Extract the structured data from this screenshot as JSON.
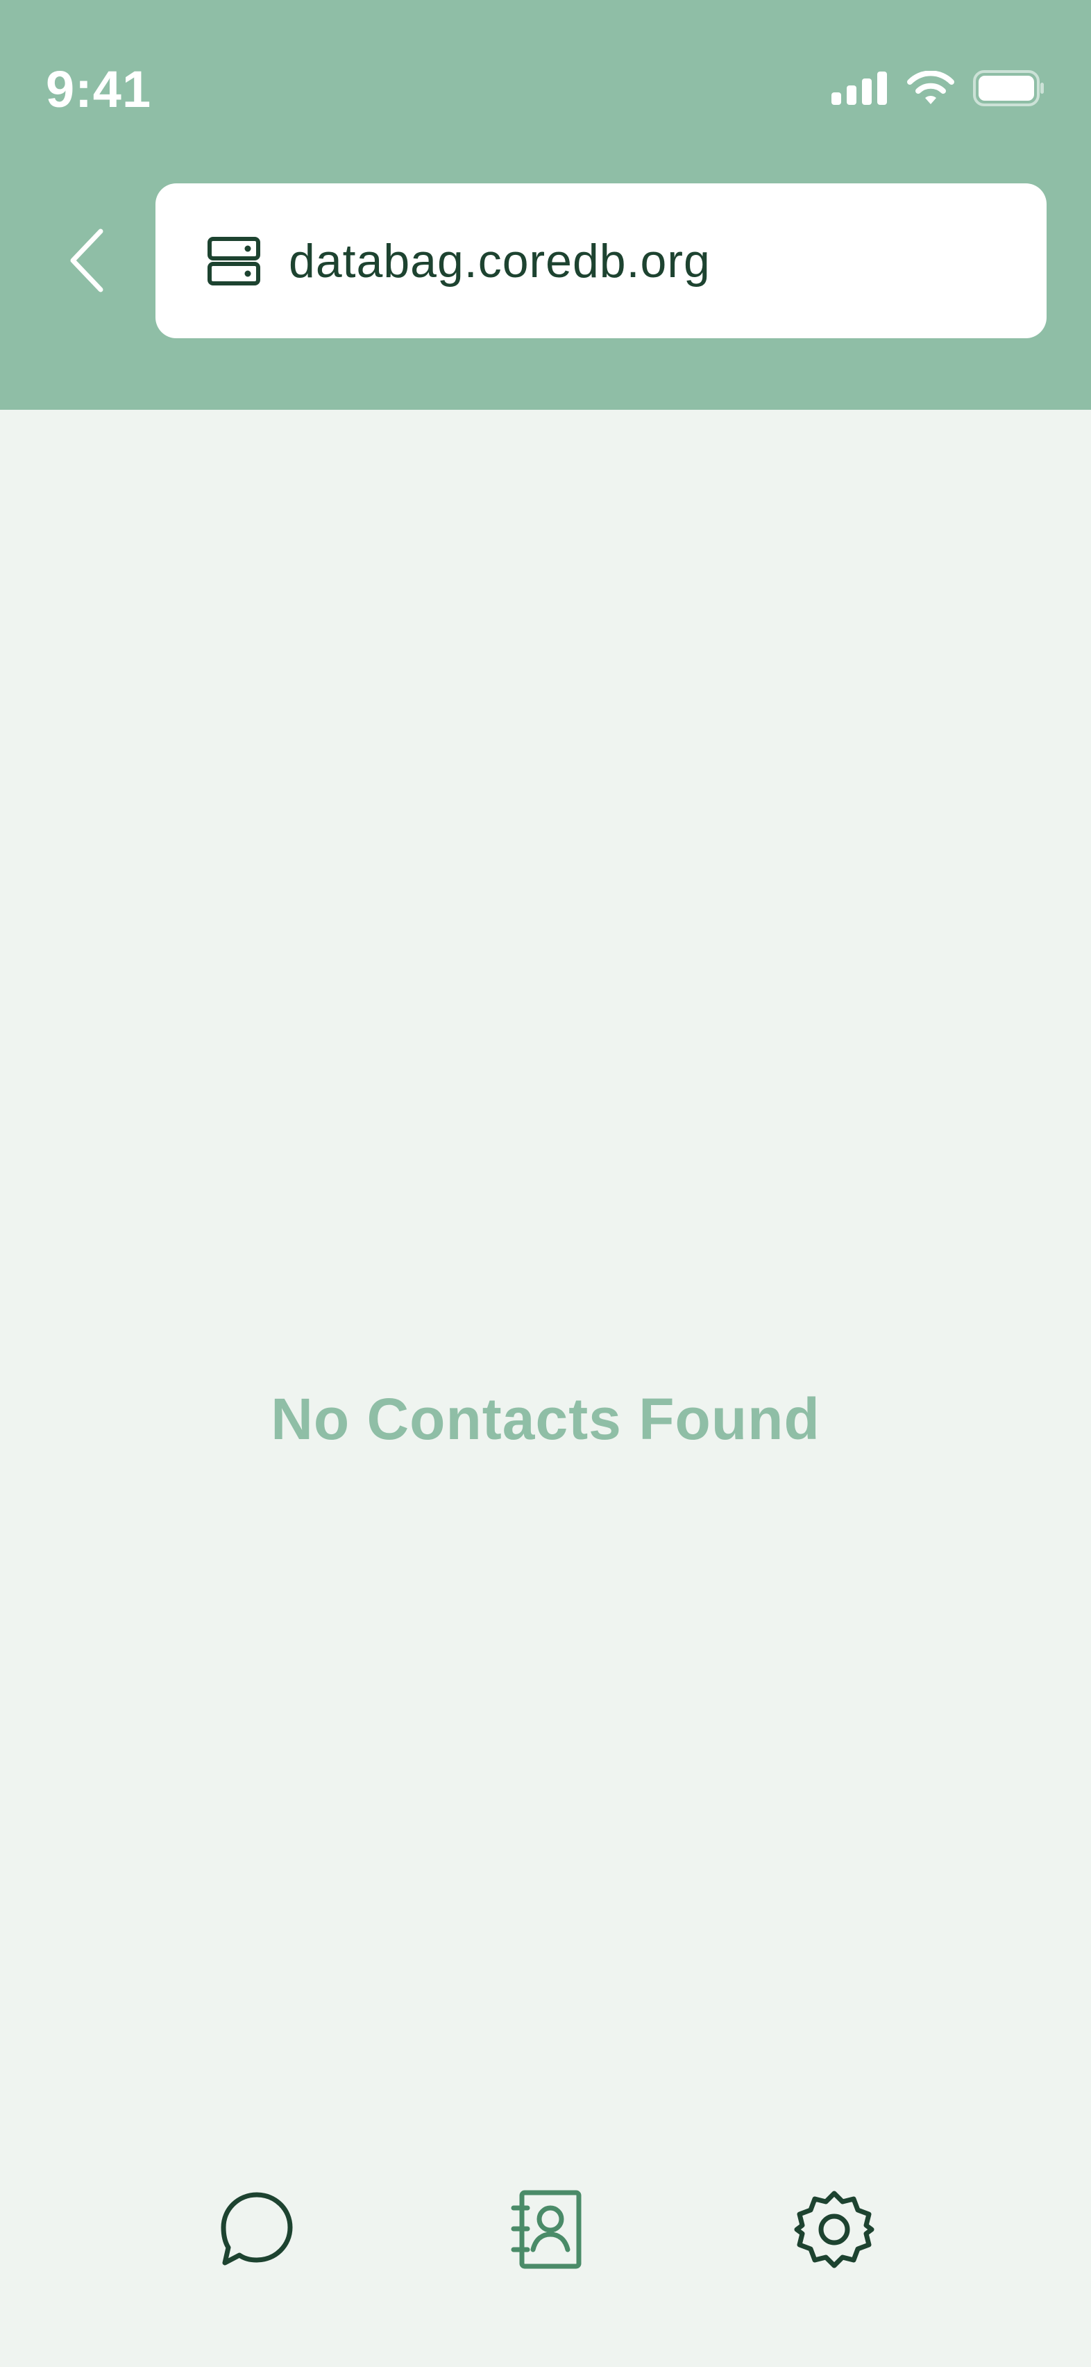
{
  "status_bar": {
    "time": "9:41",
    "icons": [
      "signal-icon",
      "wifi-icon",
      "battery-icon"
    ]
  },
  "header": {
    "back_icon": "chevron-left-icon",
    "server_icon": "server-icon",
    "server_url": "databag.coredb.org"
  },
  "main": {
    "empty_message": "No Contacts Found"
  },
  "tab_bar": {
    "tabs": [
      {
        "name": "chats",
        "icon": "chat-bubble-icon",
        "active": false
      },
      {
        "name": "contacts",
        "icon": "contact-book-icon",
        "active": true
      },
      {
        "name": "settings",
        "icon": "gear-icon",
        "active": false
      }
    ]
  },
  "colors": {
    "header_bg": "#8fbea6",
    "page_bg": "#eff4f0",
    "accent": "#4a8b68",
    "dark": "#1d4330"
  }
}
